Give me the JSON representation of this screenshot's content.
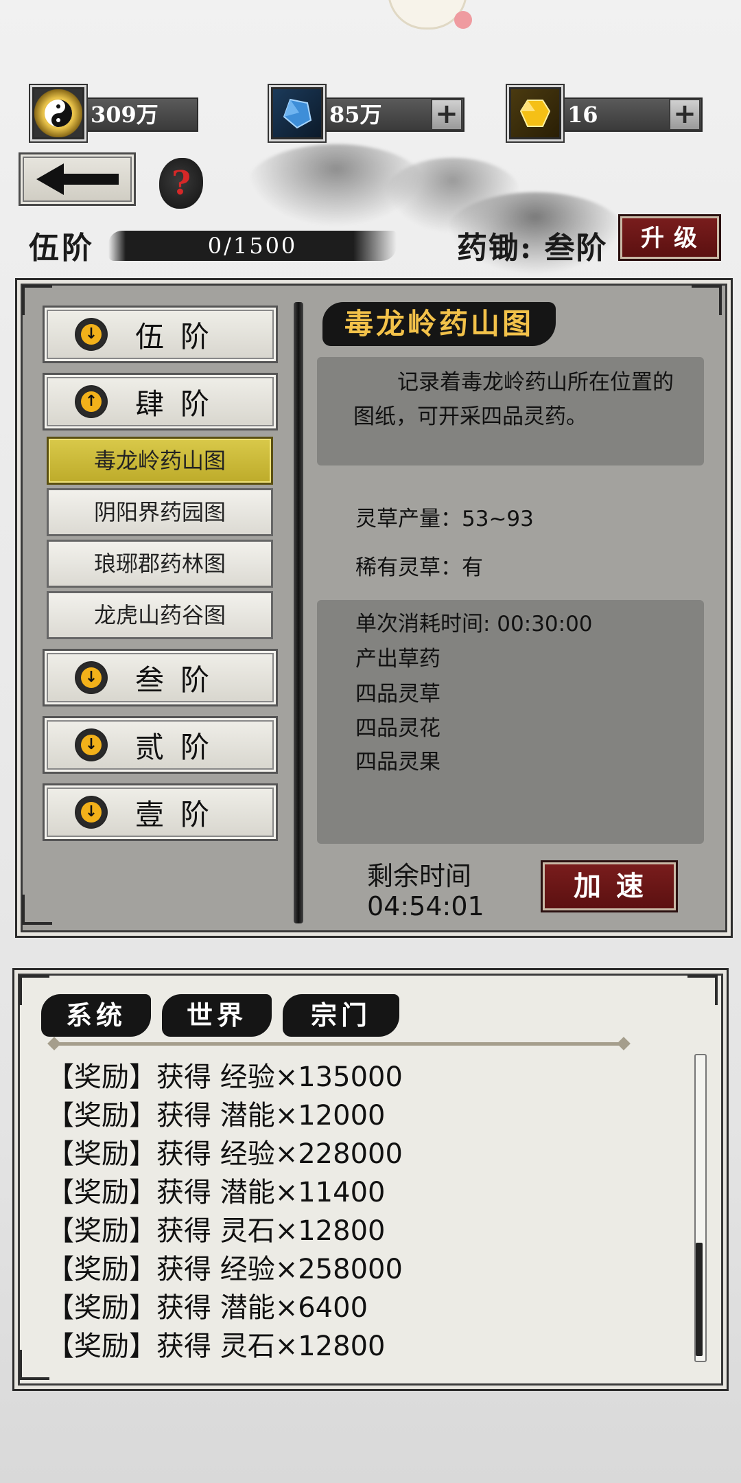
{
  "currency": {
    "yinyang": {
      "icon": "yinyang-coin-icon",
      "value": "309万"
    },
    "crystal": {
      "icon": "blue-crystal-icon",
      "value": "85万"
    },
    "gem": {
      "icon": "gold-gem-icon",
      "value": "16"
    }
  },
  "rank": {
    "label": "伍阶",
    "progress": "0/1500",
    "progress_value": 0,
    "progress_max": 1500
  },
  "hoe": {
    "label": "药锄: 叁阶",
    "upgrade": "升级"
  },
  "tiers": [
    {
      "label": "伍阶",
      "icon": "arrow-down-icon"
    },
    {
      "label": "肆阶",
      "icon": "arrow-up-icon"
    },
    {
      "label": "叁阶",
      "icon": "arrow-down-icon"
    },
    {
      "label": "贰阶",
      "icon": "arrow-down-icon"
    },
    {
      "label": "壹阶",
      "icon": "arrow-down-icon"
    }
  ],
  "maps": [
    "毒龙岭药山图",
    "阴阳界药园图",
    "琅琊郡药林图",
    "龙虎山药谷图"
  ],
  "detail": {
    "title": "毒龙岭药山图",
    "description": "记录着毒龙岭药山所在位置的图纸，可开采四品灵药。",
    "yield": "灵草产量：53~93",
    "rare": "稀有灵草：有",
    "consume": "单次消耗时间: 00:30:00",
    "output_title": "产出草药",
    "outputs": [
      "四品灵草",
      "四品灵花",
      "四品灵果"
    ],
    "remain_label": "剩余时间",
    "remain_time": "04:54:01",
    "speed_button": "加速"
  },
  "chat": {
    "tabs": [
      "系统",
      "世界",
      "宗门"
    ],
    "lines": [
      "【奖励】获得 经验×135000",
      "【奖励】获得 潜能×12000",
      "【奖励】获得 经验×228000",
      "【奖励】获得 潜能×11400",
      "【奖励】获得 灵石×12800",
      "【奖励】获得 经验×258000",
      "【奖励】获得 潜能×6400",
      "【奖励】获得 灵石×12800"
    ]
  },
  "colors": {
    "accent_red": "#6b1616",
    "selected_gold": "#cdbb38",
    "panel_gray": "#a3a29e"
  }
}
